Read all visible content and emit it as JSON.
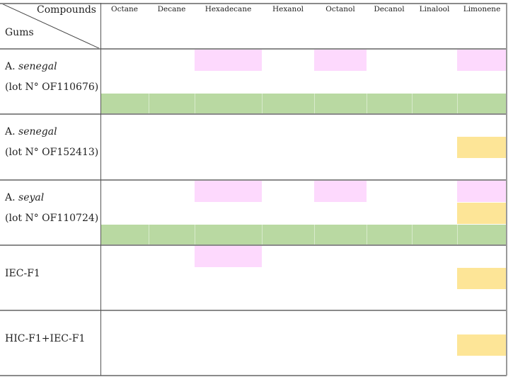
{
  "table": {
    "corner": {
      "top_label": "Compounds",
      "bottom_label": "Gums"
    },
    "columns": [
      "Octane",
      "Decane",
      "Hexadecane",
      "Hexanol",
      "Octanol",
      "Decanol",
      "Linalool",
      "Limonene"
    ],
    "colors": {
      "pink": "#fdd9fd",
      "yellow": "#fde597",
      "green": "#b9d9a2",
      "border": "#8a8a8a"
    },
    "rows": [
      {
        "genus": "A. ",
        "species": "senegal",
        "lot": "(lot N° OF110676)",
        "marks": [
          {
            "color": "pink",
            "columns": [
              "Hexadecane"
            ],
            "band": 0
          },
          {
            "color": "pink",
            "columns": [
              "Octanol"
            ],
            "band": 0
          },
          {
            "color": "pink",
            "columns": [
              "Limonene"
            ],
            "band": 0
          },
          {
            "color": "green",
            "columns": [
              "Octane",
              "Decane",
              "Hexadecane",
              "Hexanol",
              "Octanol",
              "Decanol",
              "Linalool",
              "Limonene"
            ],
            "band": 2
          }
        ]
      },
      {
        "genus": "A. ",
        "species": "senegal",
        "lot": "(lot N° OF152413)",
        "marks": [
          {
            "color": "yellow",
            "columns": [
              "Limonene"
            ],
            "band": 1
          }
        ]
      },
      {
        "genus": "A. ",
        "species": "seyal",
        "lot": "(lot N° OF110724)",
        "marks": [
          {
            "color": "pink",
            "columns": [
              "Hexadecane"
            ],
            "band": 0
          },
          {
            "color": "pink",
            "columns": [
              "Octanol"
            ],
            "band": 0
          },
          {
            "color": "pink",
            "columns": [
              "Limonene"
            ],
            "band": 0
          },
          {
            "color": "yellow",
            "columns": [
              "Limonene"
            ],
            "band": 1
          },
          {
            "color": "green",
            "columns": [
              "Octane",
              "Decane",
              "Hexadecane",
              "Hexanol",
              "Octanol",
              "Decanol",
              "Linalool",
              "Limonene"
            ],
            "band": 2
          }
        ]
      },
      {
        "label": "IEC-F1",
        "marks": [
          {
            "color": "pink",
            "columns": [
              "Hexadecane"
            ],
            "band": 0
          },
          {
            "color": "yellow",
            "columns": [
              "Limonene"
            ],
            "band": 1
          }
        ]
      },
      {
        "label": "HIC-F1+IEC-F1",
        "marks": [
          {
            "color": "yellow",
            "columns": [
              "Limonene"
            ],
            "band": 1.05
          }
        ]
      }
    ]
  }
}
